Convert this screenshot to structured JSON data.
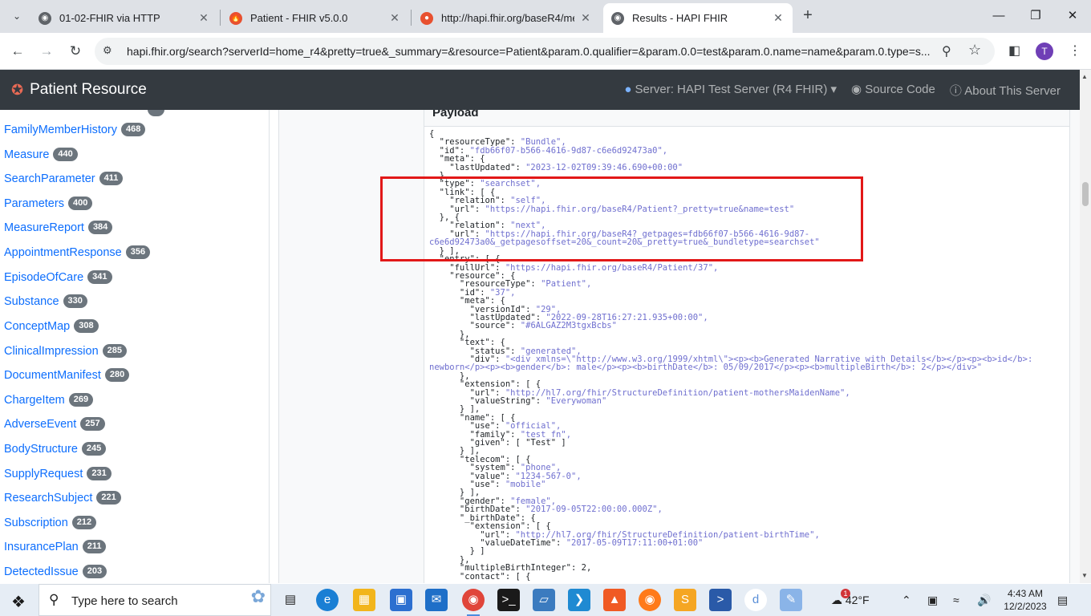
{
  "browser": {
    "tabs": [
      {
        "title": "01-02-FHIR via HTTP",
        "active": false
      },
      {
        "title": "Patient - FHIR v5.0.0",
        "active": false
      },
      {
        "title": "http://hapi.fhir.org/baseR4/me",
        "active": false
      },
      {
        "title": "Results - HAPI FHIR",
        "active": true
      }
    ],
    "url": "hapi.fhir.org/search?serverId=home_r4&pretty=true&_summary=&resource=Patient&param.0.qualifier=&param.0.0=test&param.0.name=name&param.0.type=s...",
    "profile_initial": "T"
  },
  "navbar": {
    "brand": "Patient Resource",
    "server": "Server: HAPI Test Server (R4 FHIR)",
    "source_code": "Source Code",
    "about": "About This Server"
  },
  "sidebar": {
    "items": [
      {
        "label": "FamilyMemberHistory",
        "count": "468"
      },
      {
        "label": "Measure",
        "count": "440"
      },
      {
        "label": "SearchParameter",
        "count": "411"
      },
      {
        "label": "Parameters",
        "count": "400"
      },
      {
        "label": "MeasureReport",
        "count": "384"
      },
      {
        "label": "AppointmentResponse",
        "count": "356"
      },
      {
        "label": "EpisodeOfCare",
        "count": "341"
      },
      {
        "label": "Substance",
        "count": "330"
      },
      {
        "label": "ConceptMap",
        "count": "308"
      },
      {
        "label": "ClinicalImpression",
        "count": "285"
      },
      {
        "label": "DocumentManifest",
        "count": "280"
      },
      {
        "label": "ChargeItem",
        "count": "269"
      },
      {
        "label": "AdverseEvent",
        "count": "257"
      },
      {
        "label": "BodyStructure",
        "count": "245"
      },
      {
        "label": "SupplyRequest",
        "count": "231"
      },
      {
        "label": "ResearchSubject",
        "count": "221"
      },
      {
        "label": "Subscription",
        "count": "212"
      },
      {
        "label": "InsurancePlan",
        "count": "211"
      },
      {
        "label": "DetectedIssue",
        "count": "203"
      }
    ]
  },
  "payload": {
    "header": "Payload",
    "lines": [
      "{",
      "  \"resourceType\": \"Bundle\",",
      "  \"id\": \"fdb66f07-b566-4616-9d87-c6e6d92473a0\",",
      "  \"meta\": {",
      "    \"lastUpdated\": \"2023-12-02T09:39:46.690+00:00\"",
      "  },",
      "  \"type\": \"searchset\",",
      "  \"link\": [ {",
      "    \"relation\": \"self\",",
      "    \"url\": \"https://hapi.fhir.org/baseR4/Patient?_pretty=true&name=test\"",
      "  }, {",
      "    \"relation\": \"next\",",
      "    \"url\": \"https://hapi.fhir.org/baseR4?_getpages=fdb66f07-b566-4616-9d87-",
      "c6e6d92473a0&_getpagesoffset=20&_count=20&_pretty=true&_bundletype=searchset\"",
      "  } ],",
      "  \"entry\": [ {",
      "    \"fullUrl\": \"https://hapi.fhir.org/baseR4/Patient/37\",",
      "    \"resource\": {",
      "      \"resourceType\": \"Patient\",",
      "      \"id\": \"37\",",
      "      \"meta\": {",
      "        \"versionId\": \"29\",",
      "        \"lastUpdated\": \"2022-09-28T16:27:21.935+00:00\",",
      "        \"source\": \"#6ALGAZ2M3tgxBcbs\"",
      "      },",
      "      \"text\": {",
      "        \"status\": \"generated\",",
      "        \"div\": \"<div xmlns=\\\"http://www.w3.org/1999/xhtml\\\"><p><b>Generated Narrative with Details</b></p><p><b>id</b>:",
      "newborn</p><p><b>gender</b>: male</p><p><b>birthDate</b>: 05/09/2017</p><p><b>multipleBirth</b>: 2</p></div>\"",
      "      },",
      "      \"extension\": [ {",
      "        \"url\": \"http://hl7.org/fhir/StructureDefinition/patient-mothersMaidenName\",",
      "        \"valueString\": \"Everywoman\"",
      "      } ],",
      "      \"name\": [ {",
      "        \"use\": \"official\",",
      "        \"family\": \"test_fn\",",
      "        \"given\": [ \"Test\" ]",
      "      } ],",
      "      \"telecom\": [ {",
      "        \"system\": \"phone\",",
      "        \"value\": \"1234-567-0\",",
      "        \"use\": \"mobile\"",
      "      } ],",
      "      \"gender\": \"female\",",
      "      \"birthDate\": \"2017-09-05T22:00:00.000Z\",",
      "      \"_birthDate\": {",
      "        \"extension\": [ {",
      "          \"url\": \"http://hl7.org/fhir/StructureDefinition/patient-birthTime\",",
      "          \"valueDateTime\": \"2017-05-09T17:11:00+01:00\"",
      "        } ]",
      "      },",
      "      \"multipleBirthInteger\": 2,",
      "      \"contact\": [ {"
    ]
  },
  "taskbar": {
    "search_placeholder": "Type here to search",
    "weather": "42°F",
    "time": "4:43 AM",
    "date": "12/2/2023",
    "notification_count": "1"
  },
  "colors": {
    "navbar_bg": "#343a40",
    "link": "#0d6efd",
    "badge": "#6c757d",
    "highlight_box": "#e21818",
    "json_string": "#6f6fcf"
  }
}
